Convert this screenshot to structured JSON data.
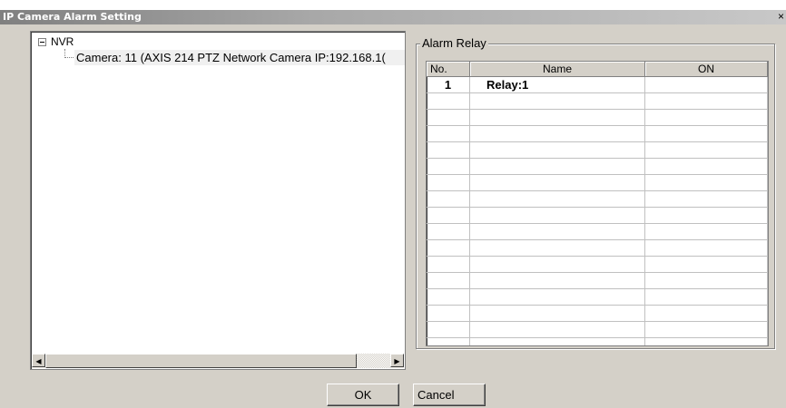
{
  "window": {
    "title": "IP Camera Alarm Setting",
    "close_glyph": "×"
  },
  "tree": {
    "root_label": "NVR",
    "child_label": "Camera: 11 (AXIS 214 PTZ Network Camera IP:192.168.1("
  },
  "alarm_relay": {
    "group_label": "Alarm Relay",
    "columns": [
      "No.",
      "Name",
      "ON"
    ],
    "rows": [
      {
        "no": "1",
        "name": "Relay:1",
        "on": ""
      }
    ],
    "empty_row_count": 16
  },
  "buttons": {
    "ok": "OK",
    "cancel": "Cancel"
  },
  "scrollbar": {
    "left_arrow": "◀",
    "right_arrow": "▶"
  }
}
